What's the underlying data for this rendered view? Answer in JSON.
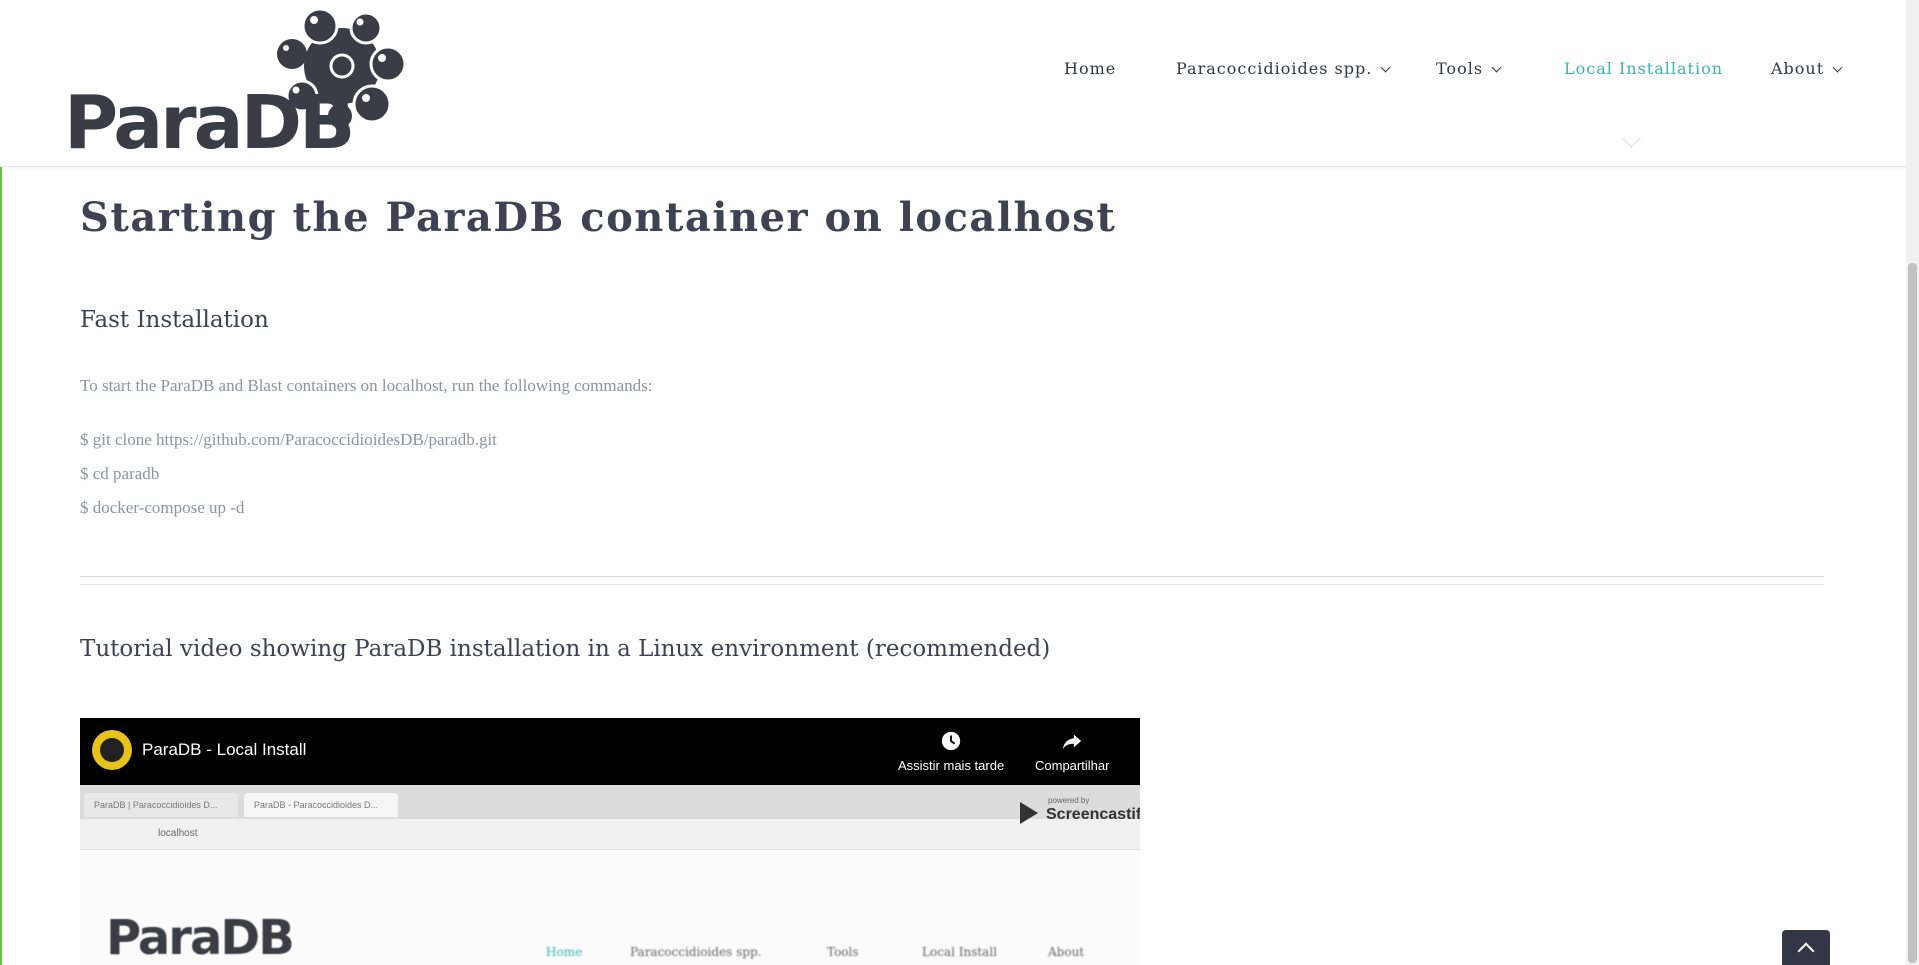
{
  "brand": {
    "logo_text": "ParaDB"
  },
  "nav": {
    "items": [
      {
        "label": "Home"
      },
      {
        "label": "Paracoccidioides spp."
      },
      {
        "label": "Tools"
      },
      {
        "label": "Local Installation"
      },
      {
        "label": "About"
      }
    ],
    "active_color": "#3fb2b0"
  },
  "content": {
    "title": "Starting the ParaDB container on localhost",
    "fast_heading": "Fast Installation",
    "intro": "To start the ParaDB and Blast containers on localhost, run the following commands:",
    "commands": [
      "$ git clone https://github.com/ParacoccidioidesDB/paradb.git",
      "$ cd paradb",
      "$ docker-compose up -d"
    ],
    "tutorial_heading": "Tutorial video showing ParaDB installation in a Linux environment (recommended)"
  },
  "video": {
    "title": "ParaDB - Local Install",
    "watch_later": "Assistir mais tarde",
    "share": "Compartilhar",
    "tabs": [
      "ParaDB | Paracoccidioides D...",
      "ParaDB - Paracoccidioides D..."
    ],
    "address": "localhost",
    "watermark_small": "powered by",
    "watermark": "Screencastify",
    "inner_logo": "ParaDB",
    "inner_nav": [
      "Home",
      "Paracoccidioides spp.",
      "Tools",
      "Local Install",
      "About"
    ]
  },
  "icons": {
    "watch_later": "clock-icon",
    "share": "share-icon",
    "to_top": "chevron-up-icon"
  }
}
